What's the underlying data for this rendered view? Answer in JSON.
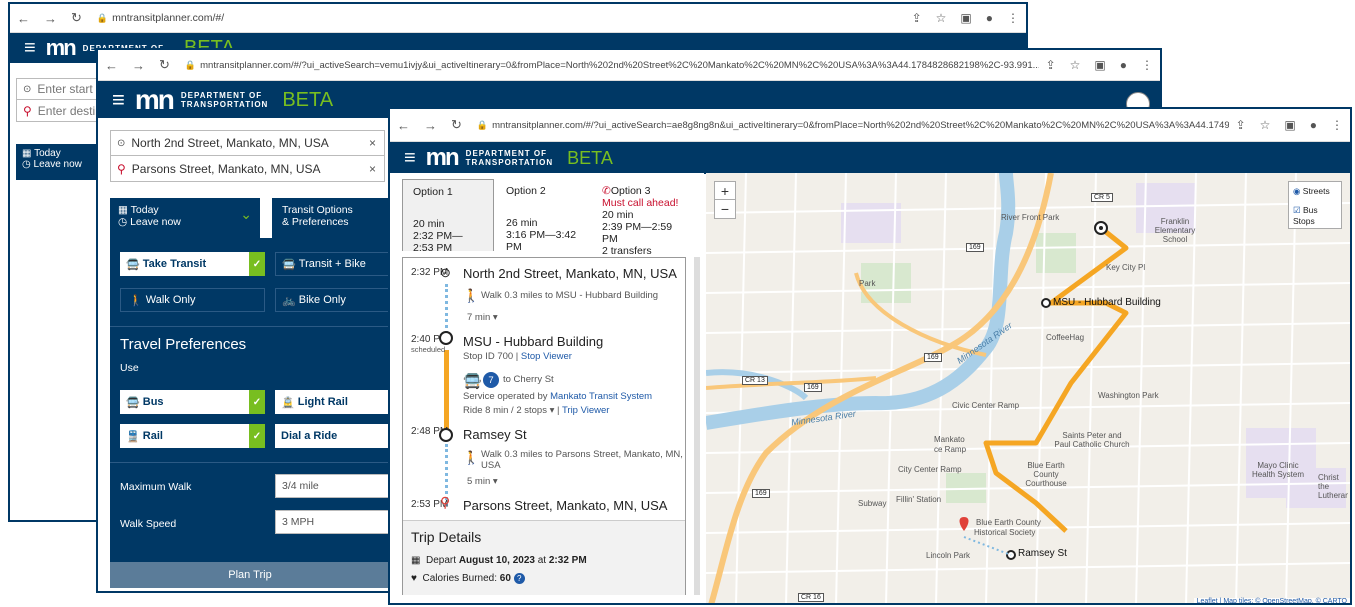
{
  "win1": {
    "url": "mntransitplanner.com/#/",
    "beta": "BETA",
    "dept": "DEPARTMENT OF",
    "start_placeholder": "Enter start l",
    "dest_placeholder": "Enter destin",
    "today": "Today",
    "leave_now": "Leave now"
  },
  "win2": {
    "url": "mntransitplanner.com/#/?ui_activeSearch=vemu1ivjy&ui_activeItinerary=0&fromPlace=North%202nd%20Street%2C%20Mankato%2C%20MN%2C%20USA%3A%3A44.1784828682198%2C-93.991...",
    "dept": "DEPARTMENT OF",
    "trans": "TRANSPORTATION",
    "beta": "BETA",
    "from": "North 2nd Street, Mankato, MN, USA",
    "to": "Parsons Street, Mankato, MN, USA",
    "today": "Today",
    "leave_now": "Leave now",
    "transit_options": "Transit Options",
    "preferences": "& Preferences",
    "take_transit": "Take Transit",
    "transit_bike": "Transit + Bike",
    "walk_only": "Walk Only",
    "bike_only": "Bike Only",
    "travel_prefs": "Travel Preferences",
    "use": "Use",
    "bus": "Bus",
    "light_rail": "Light Rail",
    "rail": "Rail",
    "dial_ride": "Dial a Ride",
    "max_walk_label": "Maximum Walk",
    "max_walk_value": "3/4 mile",
    "walk_speed_label": "Walk Speed",
    "walk_speed_value": "3 MPH",
    "plan_trip": "Plan Trip"
  },
  "win3": {
    "url": "mntransitplanner.com/#/?ui_activeSearch=ae8g8ng8n&ui_activeItinerary=0&fromPlace=North%202nd%20Street%2C%20Mankato%2C%20MN%2C%20USA%3A%3A44.174941202119996%2C-93....",
    "dept": "DEPARTMENT OF",
    "trans": "TRANSPORTATION",
    "beta": "BETA",
    "options": [
      {
        "name": "Option 1",
        "warn": "",
        "dur": "20 min",
        "time": "2:32 PM—2:53 PM"
      },
      {
        "name": "Option 2",
        "warn": "",
        "dur": "26 min",
        "time": "3:16 PM—3:42 PM"
      },
      {
        "name": "Option 3",
        "warn": "Must call ahead!",
        "dur": "20 min",
        "time": "2:39 PM—2:59 PM",
        "extra": "2 transfers"
      }
    ],
    "itin": {
      "t1": "2:32 PM",
      "p1": "North 2nd Street, Mankato, MN, USA",
      "walk1": "Walk 0.3 miles to MSU - Hubbard Building",
      "walk1_min": "7 min",
      "t2": "2:40 PM",
      "t2_sub": "scheduled",
      "p2": "MSU - Hubbard Building",
      "stop_id": "Stop ID 700",
      "stop_viewer": "Stop Viewer",
      "route": "7",
      "to": "to Cherry St",
      "service": "Service operated by",
      "agency": "Mankato Transit System",
      "ride": "Ride 8 min / 2 stops",
      "trip_viewer": "Trip Viewer",
      "t3": "2:48 PM",
      "p3": "Ramsey St",
      "walk2": "Walk 0.3 miles to Parsons Street, Mankato, MN,",
      "walk2b": "USA",
      "walk2_min": "5 min",
      "t4": "2:53 PM",
      "p4": "Parsons Street, Mankato, MN, USA"
    },
    "details": {
      "title": "Trip Details",
      "depart_label": "Depart",
      "depart_date": "August 10, 2023",
      "at": "at",
      "depart_time": "2:32 PM",
      "calories_label": "Calories Burned:",
      "calories": "60"
    },
    "map": {
      "streets": "Streets",
      "bus_stops": "Bus Stops",
      "labels": [
        "River Front Park",
        "Franklin Elementary School",
        "Key City Pl",
        "MSU - Hubbard Building",
        "CoffeeHag",
        "Washington Park",
        "Civic Center Ramp",
        "Saints Peter and Paul Catholic Church",
        "Mankato",
        "ce Ramp",
        "Blue Earth County Courthouse",
        "City Center Ramp",
        "Subway",
        "Fillin' Station",
        "Blue Earth County",
        "Historical Society",
        "Lincoln Park",
        "Ramsey St",
        "Mayo Clinic Health System",
        "Christ the Lutheran",
        "Minnesota River",
        "Minnesota River",
        "Park",
        "CR 5",
        "CR 13",
        "CR 16",
        "169",
        "169",
        "169",
        "169"
      ],
      "attribution": "Leaflet | Map tiles: © OpenStreetMap, © CARTO"
    }
  }
}
